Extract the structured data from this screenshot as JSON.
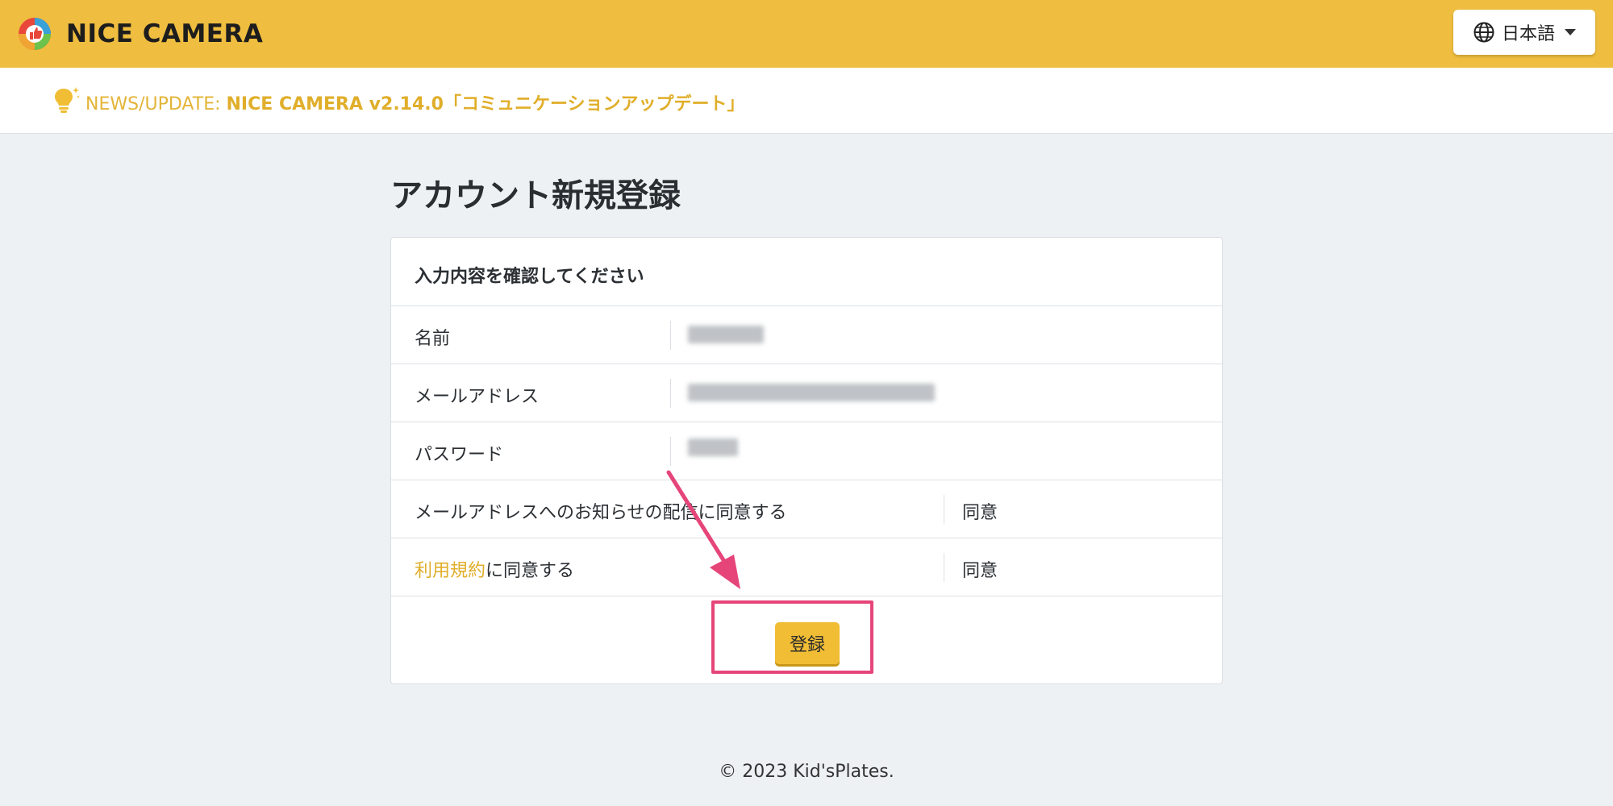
{
  "header": {
    "brand_name": "NICE CAMERA",
    "language_button": {
      "label": "日本語",
      "icon": "globe-icon"
    }
  },
  "news": {
    "prefix": "NEWS/UPDATE:",
    "link_text": "NICE CAMERA v2.14.0「コミュニケーションアップデート」",
    "icon": "lightbulb-icon"
  },
  "page": {
    "title": "アカウント新規登録"
  },
  "confirm_card": {
    "header": "入力内容を確認してください",
    "rows": [
      {
        "label": "名前",
        "value_blurred": true
      },
      {
        "label": "メールアドレス",
        "value_blurred": true
      },
      {
        "label": "パスワード",
        "value_blurred": true
      },
      {
        "label": "メールアドレスへのお知らせの配信に同意する",
        "value": "同意"
      },
      {
        "label_link": "利用規約",
        "label_suffix": "に同意する",
        "value": "同意"
      }
    ],
    "submit_label": "登録"
  },
  "footer": {
    "copyright": "© 2023 Kid'sPlates."
  },
  "colors": {
    "brand_yellow": "#efbd3f",
    "link_yellow": "#e0ae2a",
    "annotation_pink": "#e6457a",
    "page_background": "#eef1f4"
  }
}
